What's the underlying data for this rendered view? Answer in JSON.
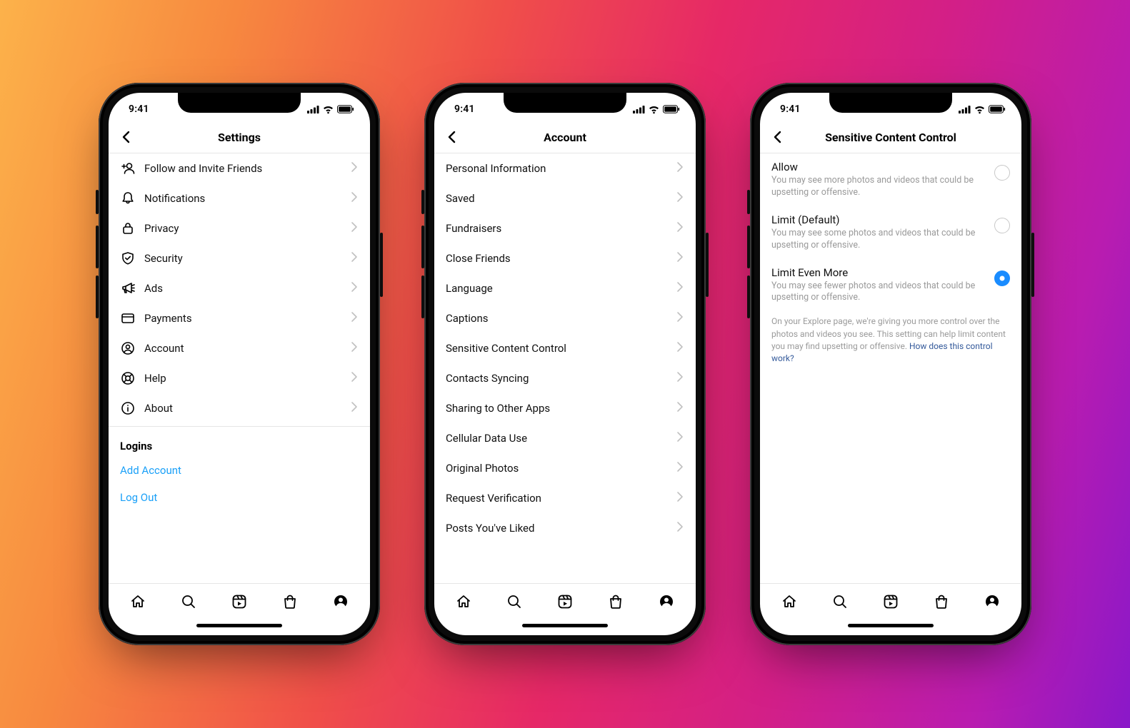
{
  "status": {
    "time": "9:41"
  },
  "screens": {
    "settings": {
      "title": "Settings",
      "items": [
        {
          "label": "Follow and Invite Friends",
          "icon": "invite"
        },
        {
          "label": "Notifications",
          "icon": "bell"
        },
        {
          "label": "Privacy",
          "icon": "lock"
        },
        {
          "label": "Security",
          "icon": "shield"
        },
        {
          "label": "Ads",
          "icon": "megaphone"
        },
        {
          "label": "Payments",
          "icon": "card"
        },
        {
          "label": "Account",
          "icon": "user-circle"
        },
        {
          "label": "Help",
          "icon": "lifebuoy"
        },
        {
          "label": "About",
          "icon": "info"
        }
      ],
      "logins_header": "Logins",
      "logins": [
        {
          "label": "Add Account"
        },
        {
          "label": "Log Out"
        }
      ]
    },
    "account": {
      "title": "Account",
      "items": [
        {
          "label": "Personal Information"
        },
        {
          "label": "Saved"
        },
        {
          "label": "Fundraisers"
        },
        {
          "label": "Close Friends"
        },
        {
          "label": "Language"
        },
        {
          "label": "Captions"
        },
        {
          "label": "Sensitive Content Control"
        },
        {
          "label": "Contacts Syncing"
        },
        {
          "label": "Sharing to Other Apps"
        },
        {
          "label": "Cellular Data Use"
        },
        {
          "label": "Original Photos"
        },
        {
          "label": "Request Verification"
        },
        {
          "label": "Posts You've Liked"
        }
      ]
    },
    "scc": {
      "title": "Sensitive Content Control",
      "options": [
        {
          "title": "Allow",
          "sub": "You may see more photos and videos that could be upsetting or offensive.",
          "checked": false
        },
        {
          "title": "Limit (Default)",
          "sub": "You may see some photos and videos that could be upsetting or offensive.",
          "checked": false
        },
        {
          "title": "Limit Even More",
          "sub": "You may see fewer photos and videos that could be upsetting or offensive.",
          "checked": true
        }
      ],
      "footer_text": "On your Explore page, we're giving you more control over the photos and videos you see. This setting can help limit content you may find upsetting or offensive. ",
      "footer_link": "How does this control work?"
    }
  }
}
